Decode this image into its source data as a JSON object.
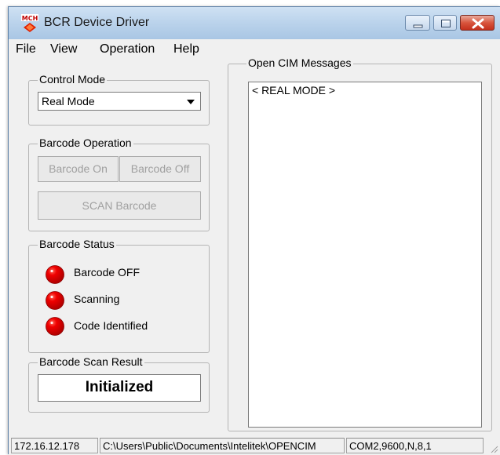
{
  "window": {
    "title": "BCR Device Driver",
    "icon": "mch-app-icon"
  },
  "menu": {
    "items": [
      "File",
      "View",
      "Operation",
      "Help"
    ]
  },
  "control_mode": {
    "group_label": "Control Mode",
    "selected": "Real Mode"
  },
  "barcode_operation": {
    "group_label": "Barcode Operation",
    "on_label": "Barcode On",
    "off_label": "Barcode Off",
    "scan_label": "SCAN Barcode"
  },
  "barcode_status": {
    "group_label": "Barcode Status",
    "items": [
      {
        "label": "Barcode OFF",
        "color": "#e00000"
      },
      {
        "label": "Scanning",
        "color": "#e00000"
      },
      {
        "label": "Code Identified",
        "color": "#e00000"
      }
    ]
  },
  "scan_result": {
    "group_label": "Barcode Scan Result",
    "value": "Initialized"
  },
  "messages": {
    "group_label": "Open CIM Messages",
    "lines": [
      "< REAL MODE >"
    ]
  },
  "statusbar": {
    "ip": "172.16.12.178",
    "path": "C:\\Users\\Public\\Documents\\Intelitek\\OPENCIM",
    "port": "COM2,9600,N,8,1"
  },
  "colors": {
    "close_button": "#c4301c",
    "led_red": "#e00000"
  }
}
